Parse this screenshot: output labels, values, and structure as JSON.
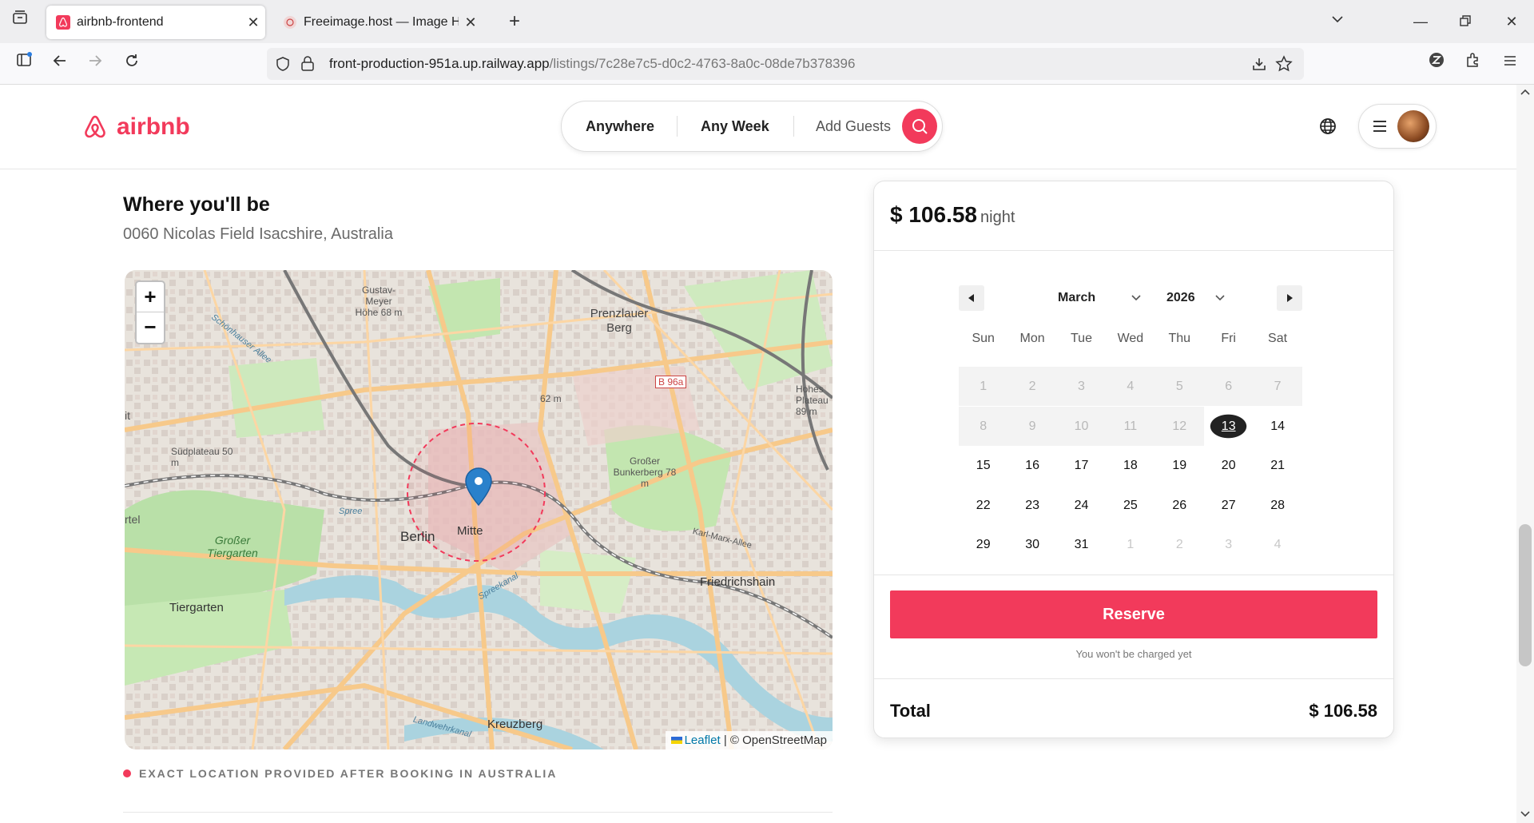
{
  "browser": {
    "tabs": [
      {
        "title": "airbnb-frontend",
        "active": true
      },
      {
        "title": "Freeimage.host — Image Hostin",
        "active": false
      }
    ],
    "url_host": "front-production-951a.up.railway.app",
    "url_path": "/listings/7c28e7c5-d0c2-4763-8a0c-08de7b378396"
  },
  "header": {
    "logo_text": "airbnb",
    "search": {
      "anywhere": "Anywhere",
      "any_week": "Any Week",
      "add_guests": "Add Guests"
    }
  },
  "location": {
    "title": "Where you'll be",
    "address": "0060 Nicolas Field Isacshire, Australia",
    "note": "EXACT LOCATION PROVIDED AFTER BOOKING IN AUSTRALIA",
    "map": {
      "zoom_in": "+",
      "zoom_out": "−",
      "attribution_link": "Leaflet",
      "attribution_rest": "| © OpenStreetMap",
      "labels": [
        "Gustav-Meyer Höhe 68 m",
        "Prenzlauer Berg",
        "B 96a",
        "62 m",
        "Hohes Plateau 89 m",
        "Südplateau 50 m",
        "Großer Bunkerberg 78 m",
        "Berlin",
        "Mitte",
        "Großer Tiergarten",
        "Karl-Marx-Allee",
        "Friedrichshain",
        "Tiergarten",
        "Kreuzberg",
        "Spree",
        "Spreekanal",
        "Landwehrkanal",
        "Schönhauser Allee",
        "rtel",
        "it"
      ]
    }
  },
  "booking": {
    "price": "$ 106.58",
    "per": "night",
    "calendar": {
      "month": "March",
      "year": "2026",
      "weekdays": [
        "Sun",
        "Mon",
        "Tue",
        "Wed",
        "Thu",
        "Fri",
        "Sat"
      ],
      "weeks": [
        [
          1,
          2,
          3,
          4,
          5,
          6,
          7
        ],
        [
          8,
          9,
          10,
          11,
          12,
          13,
          14
        ],
        [
          15,
          16,
          17,
          18,
          19,
          20,
          21
        ],
        [
          22,
          23,
          24,
          25,
          26,
          27,
          28
        ],
        [
          29,
          30,
          31,
          1,
          2,
          3,
          4
        ]
      ],
      "today": 13
    },
    "reserve_label": "Reserve",
    "no_charge": "You won't be charged yet",
    "total_label": "Total",
    "total_value": "$ 106.58"
  }
}
